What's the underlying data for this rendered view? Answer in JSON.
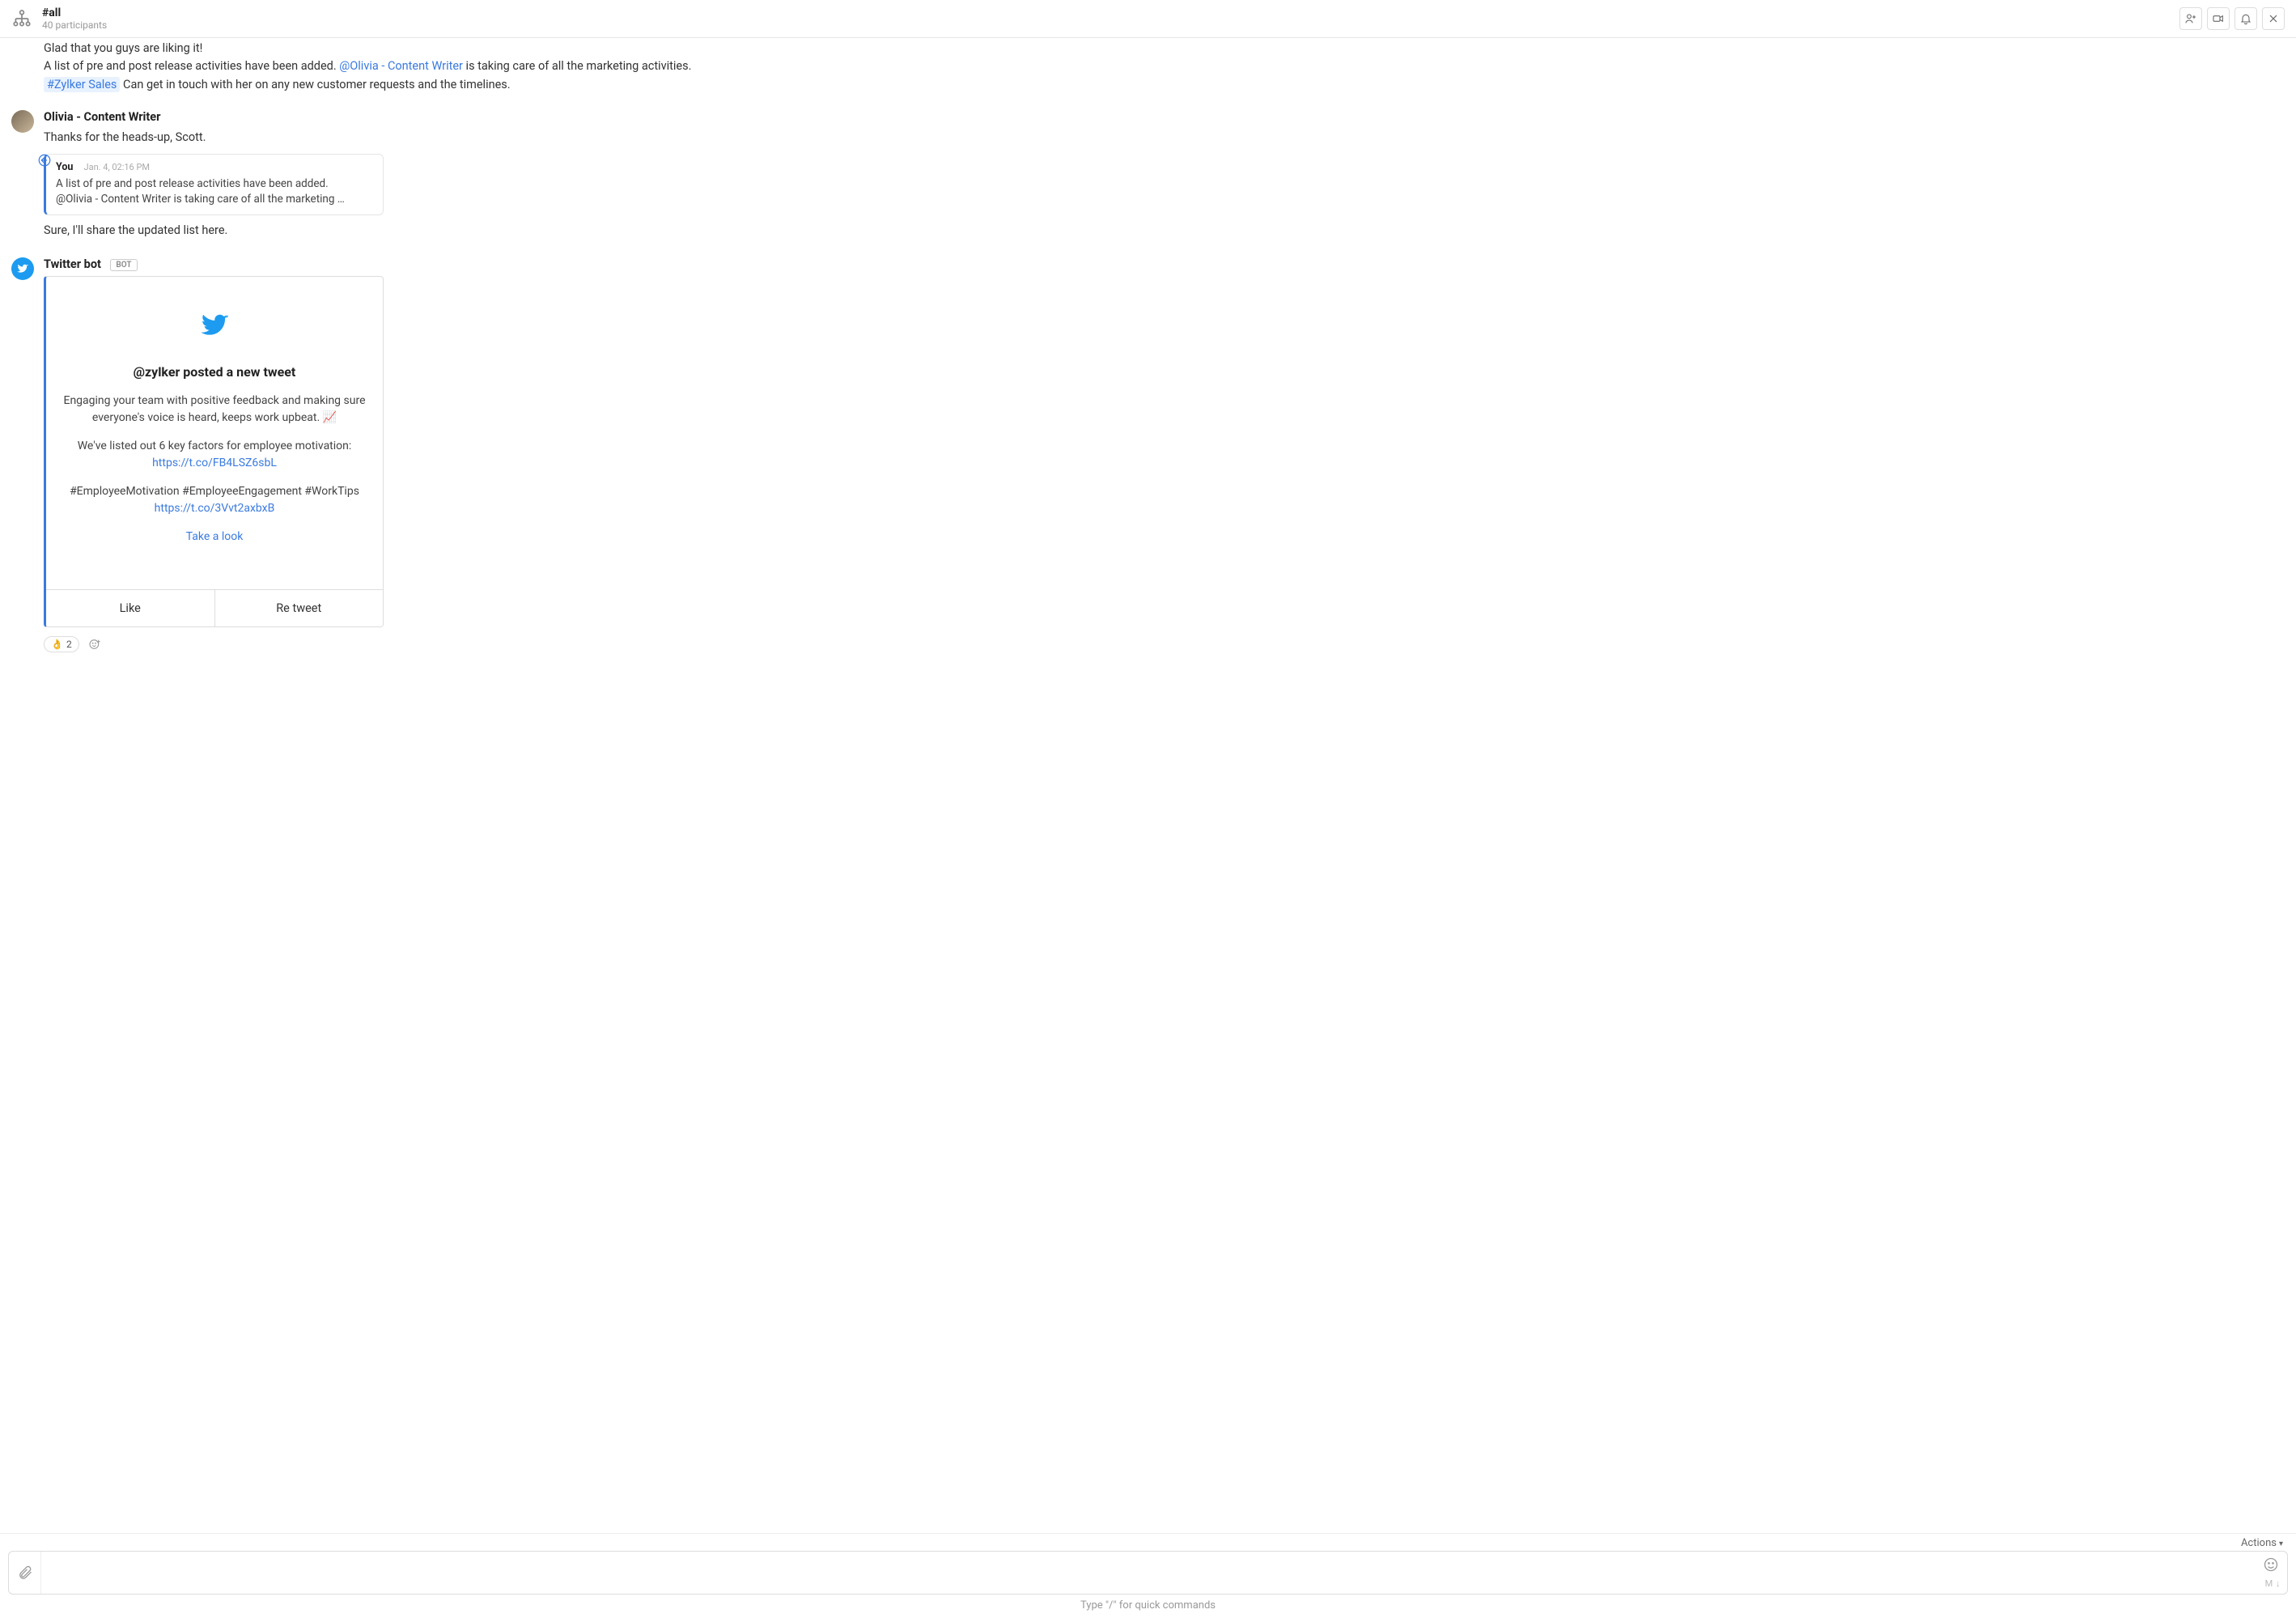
{
  "header": {
    "channel_name": "#all",
    "participants": "40 participants"
  },
  "messages": {
    "m0": {
      "line1": "Glad that you guys are liking it!",
      "line2_part1": "A list of pre and post release activities have been added. ",
      "line2_mention": "@Olivia - Content Writer",
      "line2_part2": " is taking care of all the marketing activities.",
      "line3_channel": "#Zylker Sales",
      "line3_rest": "  Can get in touch with her on any new customer requests and the timelines."
    },
    "m1": {
      "sender": "Olivia - Content Writer",
      "text": "Thanks for the heads-up, Scott.",
      "reply": {
        "you": "You",
        "ts": "Jan. 4, 02:16 PM",
        "l1": "A list of pre and post release activities have been added.",
        "l2": "@Olivia - Content Writer is taking care of all the marketing …"
      },
      "after": "Sure, I'll share the updated list here."
    },
    "m2": {
      "sender": "Twitter bot",
      "badge": "BOT",
      "card": {
        "title": "@zylker posted a new tweet",
        "p1": "Engaging your team with positive feedback and making sure everyone's voice is heard, keeps work upbeat. 📈",
        "p2": "We've listed out 6 key factors for employee motivation:",
        "link1": "https://t.co/FB4LSZ6sbL",
        "p3": "#EmployeeMotivation  #EmployeeEngagement #WorkTips",
        "link2": "https://t.co/3Vvt2axbxB",
        "take_a_look": "Take a look",
        "like": "Like",
        "retweet": "Re tweet"
      },
      "reaction": {
        "emoji": "👌",
        "count": "2"
      }
    }
  },
  "composer": {
    "actions_label": "Actions",
    "md_hint": "M ↓",
    "placeholder": ""
  },
  "footer_hint": "Type \"/\" for quick commands"
}
